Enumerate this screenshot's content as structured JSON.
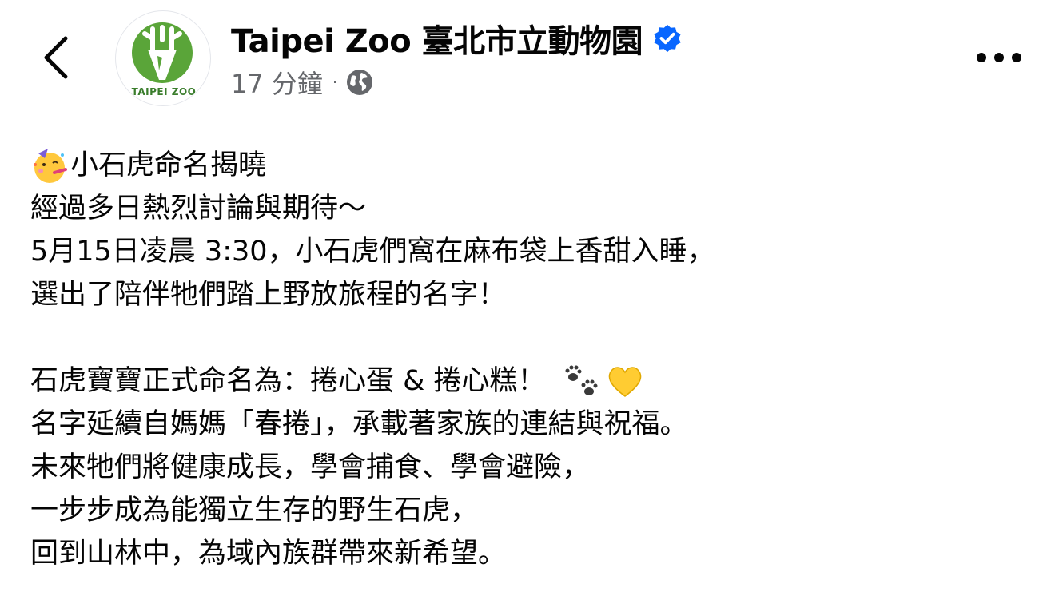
{
  "header": {
    "page_name": "Taipei Zoo 臺北市立動物園",
    "avatar_logo_text": "TAIPEI ZOO",
    "timestamp": "17 分鐘",
    "separator": "·",
    "audience_icon": "globe-icon",
    "verified_icon": "verified-badge-icon",
    "more_icon": "more-options-icon",
    "back_icon": "back-chevron-icon"
  },
  "post": {
    "line1": {
      "emoji": "partying-face-emoji",
      "text": "小石虎命名揭曉"
    },
    "line2": "經過多日熱烈討論與期待～",
    "line3": "5月15日凌晨 3:30，小石虎們窩在麻布袋上香甜入睡，",
    "line4": "選出了陪伴牠們踏上野放旅程的名字！",
    "line5": {
      "text": "石虎寶寶正式命名為：捲心蛋 & 捲心糕！",
      "emojis": [
        "paw-prints-emoji",
        "yellow-heart-emoji"
      ]
    },
    "line6": "名字延續自媽媽「春捲」，承載著家族的連結與祝福。",
    "line7": "未來牠們將健康成長，學會捕食、學會避險，",
    "line8": "一步步成為能獨立生存的野生石虎，",
    "line9": "回到山林中，為域內族群帶來新希望。"
  },
  "colors": {
    "text_primary": "#050505",
    "text_secondary": "#65676b",
    "verified_blue": "#0866ff",
    "logo_green": "#3a7d2c"
  }
}
